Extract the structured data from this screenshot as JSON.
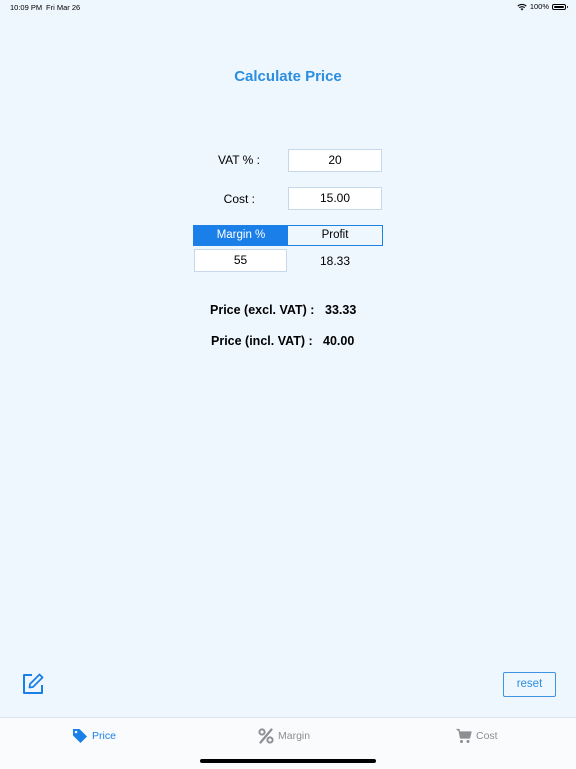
{
  "status": {
    "time": "10:09 PM",
    "date": "Fri Mar 26",
    "battery": "100%"
  },
  "title": "Calculate Price",
  "form": {
    "vat_label": "VAT % :",
    "vat_value": "20",
    "cost_label": "Cost :",
    "cost_value": "15.00",
    "segment_margin": "Margin %",
    "segment_profit": "Profit",
    "margin_value": "55",
    "profit_value": "18.33"
  },
  "results": {
    "excl_label": "Price (excl. VAT) :",
    "excl_value": "33.33",
    "incl_label": "Price (incl. VAT) :",
    "incl_value": "40.00"
  },
  "actions": {
    "reset_label": "reset"
  },
  "tabs": [
    {
      "label": "Price",
      "icon": "tag-icon",
      "active": true
    },
    {
      "label": "Margin",
      "icon": "percent-icon",
      "active": false
    },
    {
      "label": "Cost",
      "icon": "cart-icon",
      "active": false
    }
  ],
  "colors": {
    "accent": "#1a7fe8",
    "title": "#2b8ee0",
    "background": "#eef6fe",
    "inactive_tab": "#8e8e93"
  }
}
